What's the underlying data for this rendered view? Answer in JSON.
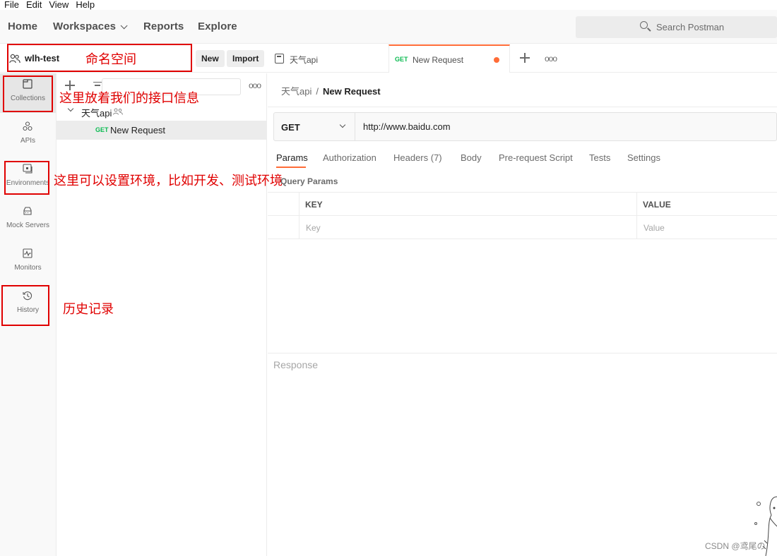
{
  "menubar": [
    "File",
    "Edit",
    "View",
    "Help"
  ],
  "nav": {
    "home": "Home",
    "workspaces": "Workspaces",
    "reports": "Reports",
    "explore": "Explore",
    "search_placeholder": "Search Postman"
  },
  "workspace": {
    "name": "wlh-test",
    "new_label": "New",
    "import_label": "Import"
  },
  "rail": [
    {
      "label": "Collections",
      "icon": "collections-icon"
    },
    {
      "label": "APIs",
      "icon": "apis-icon"
    },
    {
      "label": "Environments",
      "icon": "environments-icon"
    },
    {
      "label": "Mock Servers",
      "icon": "mock-servers-icon"
    },
    {
      "label": "Monitors",
      "icon": "monitors-icon"
    },
    {
      "label": "History",
      "icon": "history-icon"
    }
  ],
  "sidebar": {
    "collection_name": "天气api",
    "request_method": "GET",
    "request_name": "New Request"
  },
  "tabs": [
    {
      "label": "天气api"
    },
    {
      "method": "GET",
      "label": "New Request"
    }
  ],
  "breadcrumb": {
    "parent": "天气api",
    "separator": "/",
    "current": "New Request"
  },
  "request": {
    "method": "GET",
    "url": "http://www.baidu.com"
  },
  "request_tabs": [
    "Params",
    "Authorization",
    "Headers (7)",
    "Body",
    "Pre-request Script",
    "Tests",
    "Settings"
  ],
  "query_params_title": "Query Params",
  "params_table": {
    "headers": [
      "KEY",
      "VALUE"
    ],
    "placeholders": [
      "Key",
      "Value"
    ]
  },
  "response_title": "Response",
  "annotations": {
    "workspace": "命名空间",
    "collections": "这里放着我们的接口信息",
    "environments": "这里可以设置环境，比如开发、测试环境",
    "history": "历史记录"
  },
  "watermark": "CSDN @鸢尾の",
  "colors": {
    "accent": "#ff6c37",
    "get_method": "#0cbb52",
    "annotation": "#e00000"
  }
}
